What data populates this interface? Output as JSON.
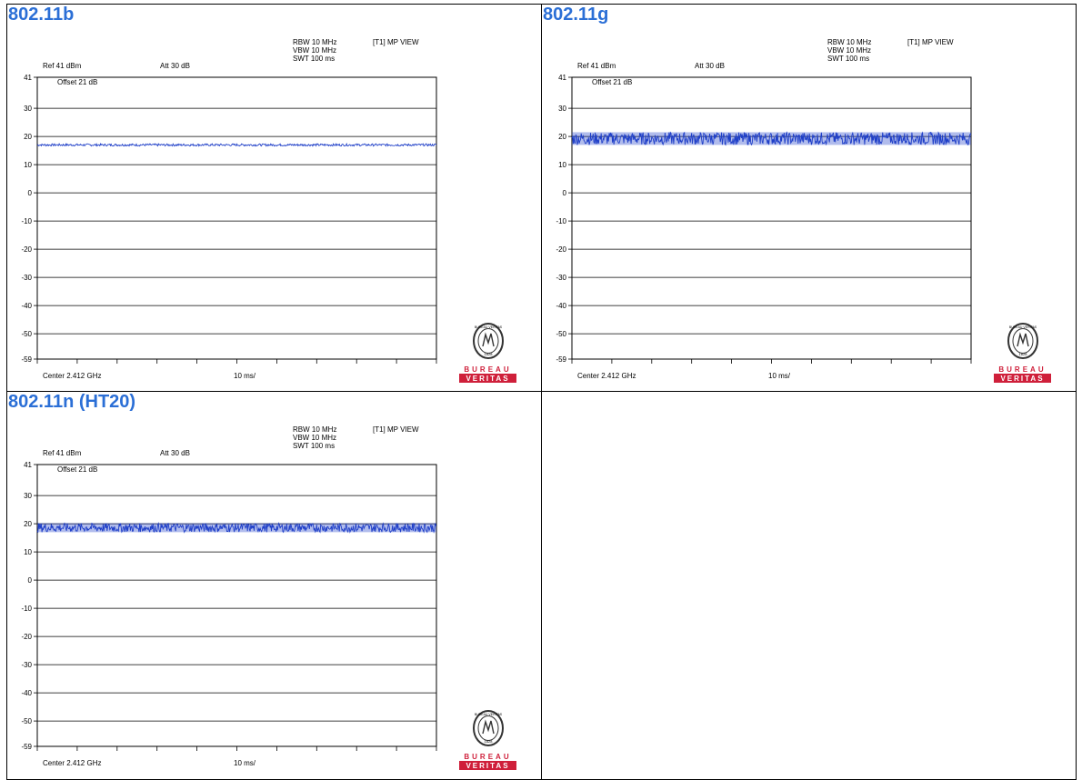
{
  "colors": {
    "title": "#2b6fd6",
    "trace": "#1f3fc8",
    "brand_red": "#cf1f3a"
  },
  "panels": [
    {
      "title": "802.11b",
      "header": {
        "rbw": "RBW 10 MHz",
        "vbw": "VBW 10 MHz",
        "swt": "SWT 100 ms",
        "view": "[T1] MP VIEW",
        "ref": "Ref 41 dBm",
        "att": "Att  30 dB",
        "offset": "Offset 21 dB"
      },
      "footer": {
        "center": "Center 2.412 GHz",
        "div": "10 ms/"
      },
      "brand": {
        "top": "BUREAU",
        "bottom": "VERITAS",
        "seal_text": "BUREAU VERITAS",
        "year": "1828"
      }
    },
    {
      "title": "802.11g",
      "header": {
        "rbw": "RBW 10 MHz",
        "vbw": "VBW 10 MHz",
        "swt": "SWT 100 ms",
        "view": "[T1] MP VIEW",
        "ref": "Ref 41 dBm",
        "att": "Att  30 dB",
        "offset": "Offset 21 dB"
      },
      "footer": {
        "center": "Center 2.412 GHz",
        "div": "10 ms/"
      },
      "brand": {
        "top": "BUREAU",
        "bottom": "VERITAS",
        "seal_text": "BUREAU VERITAS",
        "year": "1828"
      }
    },
    {
      "title": "802.11n (HT20)",
      "header": {
        "rbw": "RBW 10 MHz",
        "vbw": "VBW 10 MHz",
        "swt": "SWT 100 ms",
        "view": "[T1] MP VIEW",
        "ref": "Ref 41 dBm",
        "att": "Att  30 dB",
        "offset": "Offset 21 dB"
      },
      "footer": {
        "center": "Center 2.412 GHz",
        "div": "10 ms/"
      },
      "brand": {
        "top": "BUREAU",
        "bottom": "VERITAS",
        "seal_text": "BUREAU VERITAS",
        "year": "1828"
      }
    }
  ],
  "chart_data": [
    {
      "type": "line",
      "title": "802.11b",
      "ylim": [
        -59,
        41
      ],
      "yticks": [
        "41",
        "30",
        "20",
        "10",
        "0",
        "-10",
        "-20",
        "-30",
        "-40",
        "-50",
        "-59"
      ],
      "xlim": [
        0,
        100
      ],
      "xunit": "ms",
      "grid": true,
      "series": [
        {
          "level": 17.0,
          "spread_low": 16.6,
          "spread_high": 17.4
        }
      ]
    },
    {
      "type": "line",
      "title": "802.11g",
      "ylim": [
        -59,
        41
      ],
      "yticks": [
        "41",
        "30",
        "20",
        "10",
        "0",
        "-10",
        "-20",
        "-30",
        "-40",
        "-50",
        "-59"
      ],
      "xlim": [
        0,
        100
      ],
      "xunit": "ms",
      "grid": true,
      "series": [
        {
          "level": 19.0,
          "spread_low": 17.0,
          "spread_high": 21.5
        }
      ]
    },
    {
      "type": "line",
      "title": "802.11n (HT20)",
      "ylim": [
        -59,
        41
      ],
      "yticks": [
        "41",
        "30",
        "20",
        "10",
        "0",
        "-10",
        "-20",
        "-30",
        "-40",
        "-50",
        "-59"
      ],
      "xlim": [
        0,
        100
      ],
      "xunit": "ms",
      "grid": true,
      "series": [
        {
          "level": 18.5,
          "spread_low": 17.0,
          "spread_high": 20.2
        }
      ]
    }
  ]
}
